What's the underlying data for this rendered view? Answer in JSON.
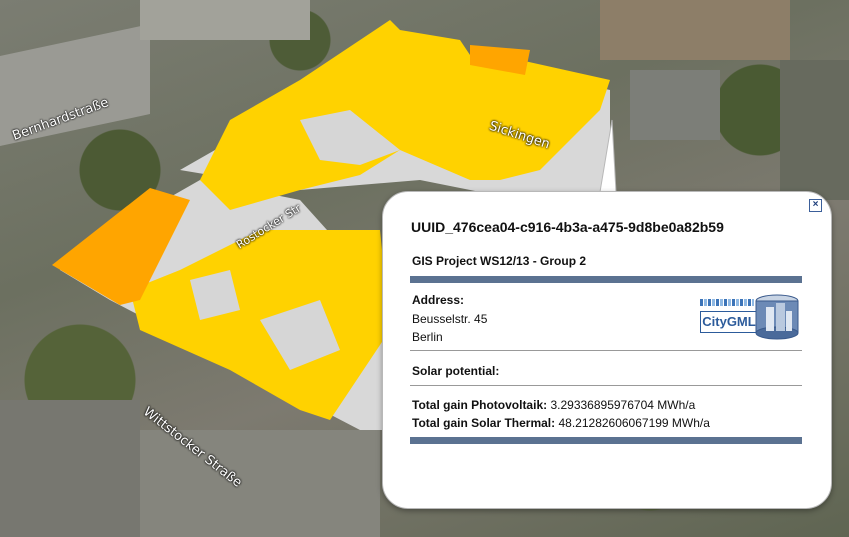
{
  "map": {
    "street_labels": [
      "Bernhardstraße",
      "Sickingen",
      "Rostocker Str",
      "Wittstocker Straße"
    ]
  },
  "balloon": {
    "title": "UUID_476cea04-c916-4b3a-a475-9d8be0a82b59",
    "project": "GIS Project WS12/13 - Group 2",
    "address_heading": "Address:",
    "address_line1": "Beusselstr. 45",
    "address_line2": "Berlin",
    "solar_heading": "Solar potential:",
    "pv_label": "Total gain Photovoltaik:",
    "pv_value": "3.29336895976704 MWh/a",
    "st_label": "Total gain Solar Thermal:",
    "st_value": "48.21282606067199 MWh/a",
    "logo_text": "CityGML",
    "close_symbol": "×",
    "accent_color": "#5b7291"
  },
  "colors": {
    "roof_yellow": "#ffd200",
    "roof_orange": "#ffa500",
    "wall_gray": "#d8d8d8"
  }
}
